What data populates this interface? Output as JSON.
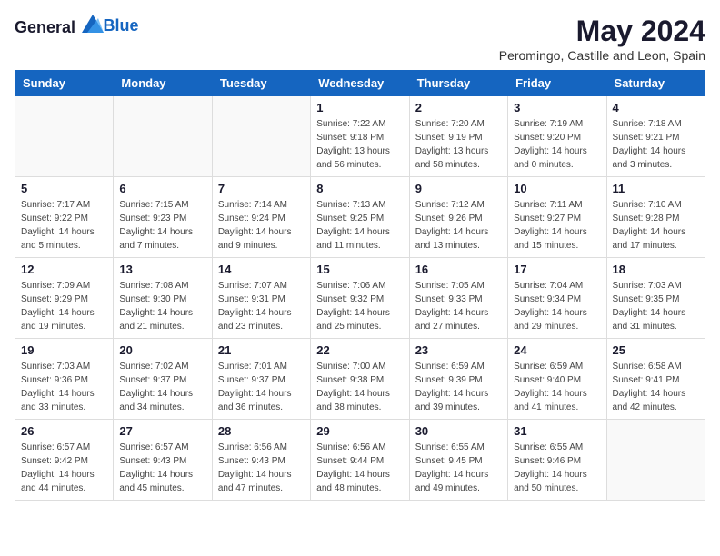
{
  "logo": {
    "text_general": "General",
    "text_blue": "Blue"
  },
  "title": "May 2024",
  "location": "Peromingo, Castille and Leon, Spain",
  "weekdays": [
    "Sunday",
    "Monday",
    "Tuesday",
    "Wednesday",
    "Thursday",
    "Friday",
    "Saturday"
  ],
  "weeks": [
    [
      {
        "day": "",
        "sunrise": "",
        "sunset": "",
        "daylight": ""
      },
      {
        "day": "",
        "sunrise": "",
        "sunset": "",
        "daylight": ""
      },
      {
        "day": "",
        "sunrise": "",
        "sunset": "",
        "daylight": ""
      },
      {
        "day": "1",
        "sunrise": "Sunrise: 7:22 AM",
        "sunset": "Sunset: 9:18 PM",
        "daylight": "Daylight: 13 hours and 56 minutes."
      },
      {
        "day": "2",
        "sunrise": "Sunrise: 7:20 AM",
        "sunset": "Sunset: 9:19 PM",
        "daylight": "Daylight: 13 hours and 58 minutes."
      },
      {
        "day": "3",
        "sunrise": "Sunrise: 7:19 AM",
        "sunset": "Sunset: 9:20 PM",
        "daylight": "Daylight: 14 hours and 0 minutes."
      },
      {
        "day": "4",
        "sunrise": "Sunrise: 7:18 AM",
        "sunset": "Sunset: 9:21 PM",
        "daylight": "Daylight: 14 hours and 3 minutes."
      }
    ],
    [
      {
        "day": "5",
        "sunrise": "Sunrise: 7:17 AM",
        "sunset": "Sunset: 9:22 PM",
        "daylight": "Daylight: 14 hours and 5 minutes."
      },
      {
        "day": "6",
        "sunrise": "Sunrise: 7:15 AM",
        "sunset": "Sunset: 9:23 PM",
        "daylight": "Daylight: 14 hours and 7 minutes."
      },
      {
        "day": "7",
        "sunrise": "Sunrise: 7:14 AM",
        "sunset": "Sunset: 9:24 PM",
        "daylight": "Daylight: 14 hours and 9 minutes."
      },
      {
        "day": "8",
        "sunrise": "Sunrise: 7:13 AM",
        "sunset": "Sunset: 9:25 PM",
        "daylight": "Daylight: 14 hours and 11 minutes."
      },
      {
        "day": "9",
        "sunrise": "Sunrise: 7:12 AM",
        "sunset": "Sunset: 9:26 PM",
        "daylight": "Daylight: 14 hours and 13 minutes."
      },
      {
        "day": "10",
        "sunrise": "Sunrise: 7:11 AM",
        "sunset": "Sunset: 9:27 PM",
        "daylight": "Daylight: 14 hours and 15 minutes."
      },
      {
        "day": "11",
        "sunrise": "Sunrise: 7:10 AM",
        "sunset": "Sunset: 9:28 PM",
        "daylight": "Daylight: 14 hours and 17 minutes."
      }
    ],
    [
      {
        "day": "12",
        "sunrise": "Sunrise: 7:09 AM",
        "sunset": "Sunset: 9:29 PM",
        "daylight": "Daylight: 14 hours and 19 minutes."
      },
      {
        "day": "13",
        "sunrise": "Sunrise: 7:08 AM",
        "sunset": "Sunset: 9:30 PM",
        "daylight": "Daylight: 14 hours and 21 minutes."
      },
      {
        "day": "14",
        "sunrise": "Sunrise: 7:07 AM",
        "sunset": "Sunset: 9:31 PM",
        "daylight": "Daylight: 14 hours and 23 minutes."
      },
      {
        "day": "15",
        "sunrise": "Sunrise: 7:06 AM",
        "sunset": "Sunset: 9:32 PM",
        "daylight": "Daylight: 14 hours and 25 minutes."
      },
      {
        "day": "16",
        "sunrise": "Sunrise: 7:05 AM",
        "sunset": "Sunset: 9:33 PM",
        "daylight": "Daylight: 14 hours and 27 minutes."
      },
      {
        "day": "17",
        "sunrise": "Sunrise: 7:04 AM",
        "sunset": "Sunset: 9:34 PM",
        "daylight": "Daylight: 14 hours and 29 minutes."
      },
      {
        "day": "18",
        "sunrise": "Sunrise: 7:03 AM",
        "sunset": "Sunset: 9:35 PM",
        "daylight": "Daylight: 14 hours and 31 minutes."
      }
    ],
    [
      {
        "day": "19",
        "sunrise": "Sunrise: 7:03 AM",
        "sunset": "Sunset: 9:36 PM",
        "daylight": "Daylight: 14 hours and 33 minutes."
      },
      {
        "day": "20",
        "sunrise": "Sunrise: 7:02 AM",
        "sunset": "Sunset: 9:37 PM",
        "daylight": "Daylight: 14 hours and 34 minutes."
      },
      {
        "day": "21",
        "sunrise": "Sunrise: 7:01 AM",
        "sunset": "Sunset: 9:37 PM",
        "daylight": "Daylight: 14 hours and 36 minutes."
      },
      {
        "day": "22",
        "sunrise": "Sunrise: 7:00 AM",
        "sunset": "Sunset: 9:38 PM",
        "daylight": "Daylight: 14 hours and 38 minutes."
      },
      {
        "day": "23",
        "sunrise": "Sunrise: 6:59 AM",
        "sunset": "Sunset: 9:39 PM",
        "daylight": "Daylight: 14 hours and 39 minutes."
      },
      {
        "day": "24",
        "sunrise": "Sunrise: 6:59 AM",
        "sunset": "Sunset: 9:40 PM",
        "daylight": "Daylight: 14 hours and 41 minutes."
      },
      {
        "day": "25",
        "sunrise": "Sunrise: 6:58 AM",
        "sunset": "Sunset: 9:41 PM",
        "daylight": "Daylight: 14 hours and 42 minutes."
      }
    ],
    [
      {
        "day": "26",
        "sunrise": "Sunrise: 6:57 AM",
        "sunset": "Sunset: 9:42 PM",
        "daylight": "Daylight: 14 hours and 44 minutes."
      },
      {
        "day": "27",
        "sunrise": "Sunrise: 6:57 AM",
        "sunset": "Sunset: 9:43 PM",
        "daylight": "Daylight: 14 hours and 45 minutes."
      },
      {
        "day": "28",
        "sunrise": "Sunrise: 6:56 AM",
        "sunset": "Sunset: 9:43 PM",
        "daylight": "Daylight: 14 hours and 47 minutes."
      },
      {
        "day": "29",
        "sunrise": "Sunrise: 6:56 AM",
        "sunset": "Sunset: 9:44 PM",
        "daylight": "Daylight: 14 hours and 48 minutes."
      },
      {
        "day": "30",
        "sunrise": "Sunrise: 6:55 AM",
        "sunset": "Sunset: 9:45 PM",
        "daylight": "Daylight: 14 hours and 49 minutes."
      },
      {
        "day": "31",
        "sunrise": "Sunrise: 6:55 AM",
        "sunset": "Sunset: 9:46 PM",
        "daylight": "Daylight: 14 hours and 50 minutes."
      },
      {
        "day": "",
        "sunrise": "",
        "sunset": "",
        "daylight": ""
      }
    ]
  ]
}
